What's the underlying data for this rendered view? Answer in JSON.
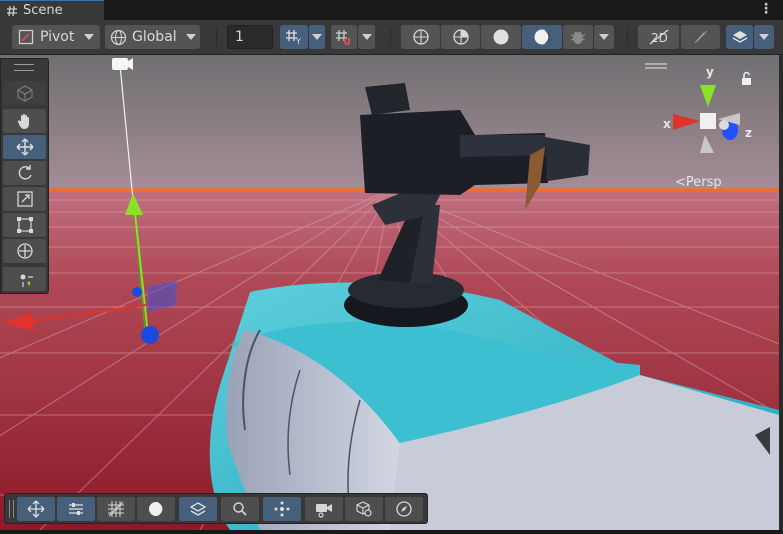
{
  "tab": {
    "title": "Scene",
    "icon": "hash-icon",
    "menu_icon": "kebab-menu-icon"
  },
  "toolbar": {
    "pivot_label": "Pivot",
    "global_label": "Global",
    "grid_size_value": "1"
  },
  "gizmo": {
    "y": "y",
    "x": "x",
    "z": "z",
    "projection_label": "<Persp"
  },
  "colors": {
    "toolbar": "#383838",
    "button": "#545454",
    "active": "#46607c",
    "sky": "#98828f",
    "horizon": "#ff6a1a",
    "grid_floor": "#a03040",
    "car_body": "#2fb3c8",
    "axis_x": "#e0332a",
    "axis_y": "#8de028",
    "axis_z": "#1a4adf"
  }
}
